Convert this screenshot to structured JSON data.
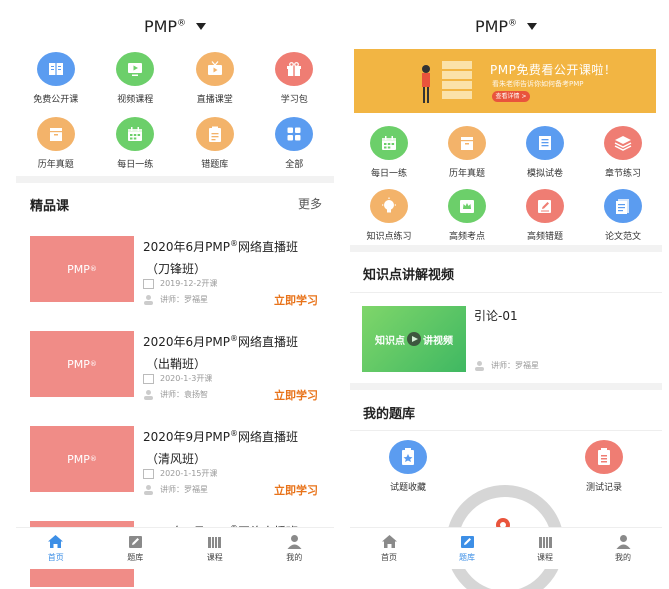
{
  "left_screen": {
    "header": {
      "title": "PMP",
      "title_sup": "®"
    },
    "grid": [
      {
        "label": "免费公开课",
        "icon": "book-icon",
        "color": "#5b9cf0"
      },
      {
        "label": "视频课程",
        "icon": "video-icon",
        "color": "#6ccf6a"
      },
      {
        "label": "直播课堂",
        "icon": "tv-icon",
        "color": "#f3b36a"
      },
      {
        "label": "学习包",
        "icon": "gift-icon",
        "color": "#ef7d73"
      },
      {
        "label": "历年真题",
        "icon": "box-icon",
        "color": "#f3b36a"
      },
      {
        "label": "每日一练",
        "icon": "calendar-icon",
        "color": "#6ccf6a"
      },
      {
        "label": "错题库",
        "icon": "clipboard-icon",
        "color": "#f3b36a"
      },
      {
        "label": "全部",
        "icon": "grid-icon",
        "color": "#5b9cf0"
      }
    ],
    "section": {
      "title": "精品课",
      "more": "更多"
    },
    "courses": [
      {
        "thumb": "PMP",
        "thumb_sup": "®",
        "title_pre": "2020年6月PMP",
        "title_sup": "®",
        "title_post": "网络直播班",
        "subtitle": "（刀锋班）",
        "date": "2019-12-2开课",
        "teacher": "讲师：罗福星",
        "action": "立即学习"
      },
      {
        "thumb": "PMP",
        "thumb_sup": "®",
        "title_pre": "2020年6月PMP",
        "title_sup": "®",
        "title_post": "网络直播班",
        "subtitle": "（出鞘班）",
        "date": "2020-1-3开课",
        "teacher": "讲师：袁扬智",
        "action": "立即学习"
      },
      {
        "thumb": "PMP",
        "thumb_sup": "®",
        "title_pre": "2020年9月PMP",
        "title_sup": "®",
        "title_post": "网络直播班",
        "subtitle": "（清风班）",
        "date": "2020-1-15开课",
        "teacher": "讲师：罗福星",
        "action": "立即学习"
      },
      {
        "thumb": "",
        "thumb_sup": "",
        "title_pre": "2020年9月PMP",
        "title_sup": "®",
        "title_post": "网络直播班",
        "subtitle": "",
        "date": "",
        "teacher": "",
        "action": ""
      }
    ],
    "tabs": [
      {
        "label": "首页",
        "icon": "home-icon",
        "active": true
      },
      {
        "label": "题库",
        "icon": "pencil-icon",
        "active": false
      },
      {
        "label": "课程",
        "icon": "books-icon",
        "active": false
      },
      {
        "label": "我的",
        "icon": "person-icon",
        "active": false
      }
    ]
  },
  "right_screen": {
    "header": {
      "title": "PMP",
      "title_sup": "®"
    },
    "banner": {
      "title": "PMP免费看公开课啦！",
      "subtitle": "看朱老师告诉你如何备考PMP",
      "button": "查看详情 >"
    },
    "grid": [
      {
        "label": "每日一练",
        "icon": "calendar-icon",
        "color": "#6ccf6a"
      },
      {
        "label": "历年真题",
        "icon": "box-icon",
        "color": "#f3b36a"
      },
      {
        "label": "模拟试卷",
        "icon": "paper-icon",
        "color": "#5b9cf0"
      },
      {
        "label": "章节练习",
        "icon": "layers-icon",
        "color": "#ef7d73"
      },
      {
        "label": "知识点练习",
        "icon": "bulb-icon",
        "color": "#f3b36a"
      },
      {
        "label": "高频考点",
        "icon": "crown-icon",
        "color": "#6ccf6a"
      },
      {
        "label": "高频错题",
        "icon": "edit-icon",
        "color": "#ef7d73"
      },
      {
        "label": "论文范文",
        "icon": "doc-icon",
        "color": "#5b9cf0"
      }
    ],
    "video_section": {
      "title": "知识点讲解视频",
      "card_text_a": "知识点",
      "card_text_b": "讲视频",
      "lesson": "引论-01",
      "teacher": "讲师：罗福星"
    },
    "bank_section": {
      "title": "我的题库",
      "left_label": "试题收藏",
      "right_label": "测试记录"
    },
    "tabs": [
      {
        "label": "首页",
        "icon": "home-icon",
        "active": false
      },
      {
        "label": "题库",
        "icon": "pencil-icon",
        "active": true
      },
      {
        "label": "课程",
        "icon": "books-icon",
        "active": false
      },
      {
        "label": "我的",
        "icon": "person-icon",
        "active": false
      }
    ]
  }
}
